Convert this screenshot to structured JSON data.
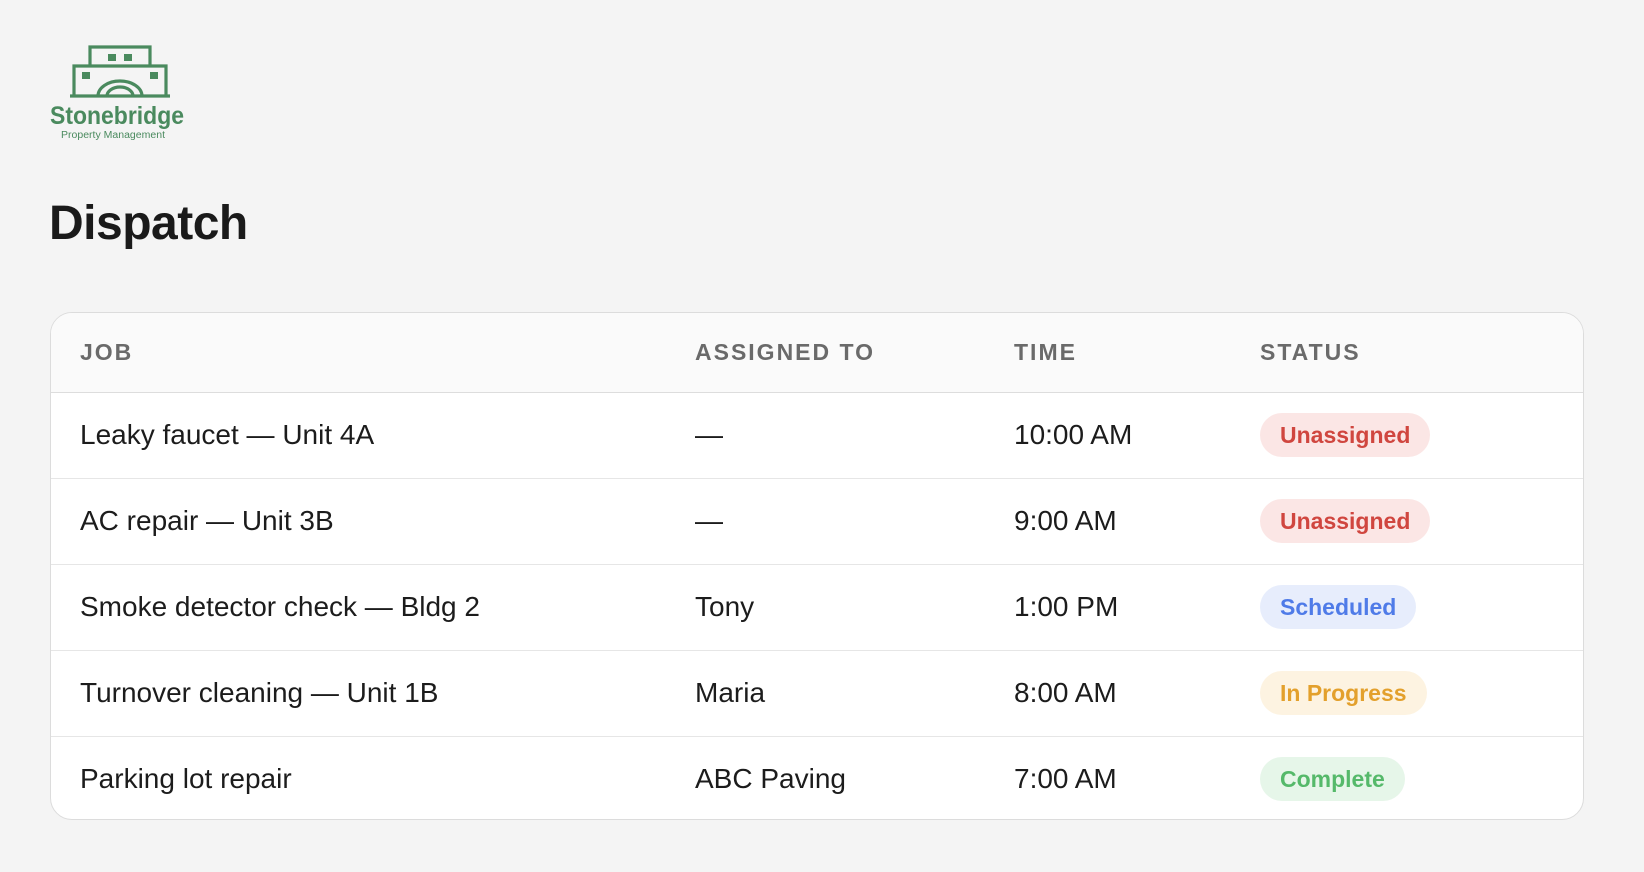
{
  "logo": {
    "name": "Stonebridge",
    "tagline": "Property Management",
    "color": "#4a8a5e"
  },
  "page": {
    "title": "Dispatch"
  },
  "table": {
    "columns": [
      "JOB",
      "ASSIGNED TO",
      "TIME",
      "STATUS"
    ],
    "rows": [
      {
        "job": "Leaky faucet — Unit 4A",
        "assigned_to": "—",
        "time": "10:00 AM",
        "status": "Unassigned",
        "status_key": "unassigned"
      },
      {
        "job": "AC repair — Unit 3B",
        "assigned_to": "—",
        "time": "9:00 AM",
        "status": "Unassigned",
        "status_key": "unassigned"
      },
      {
        "job": "Smoke detector check — Bldg 2",
        "assigned_to": "Tony",
        "time": "1:00 PM",
        "status": "Scheduled",
        "status_key": "scheduled"
      },
      {
        "job": "Turnover cleaning — Unit 1B",
        "assigned_to": "Maria",
        "time": "8:00 AM",
        "status": "In Progress",
        "status_key": "in_progress"
      },
      {
        "job": "Parking lot repair",
        "assigned_to": "ABC Paving",
        "time": "7:00 AM",
        "status": "Complete",
        "status_key": "complete"
      }
    ]
  },
  "status_colors": {
    "unassigned": {
      "text": "#d0463f",
      "bg": "#fbe6e5"
    },
    "scheduled": {
      "text": "#4f7be8",
      "bg": "#e7edfc"
    },
    "in_progress": {
      "text": "#e3a02c",
      "bg": "#fdf3e1"
    },
    "complete": {
      "text": "#55b96a",
      "bg": "#e6f6e9"
    }
  }
}
